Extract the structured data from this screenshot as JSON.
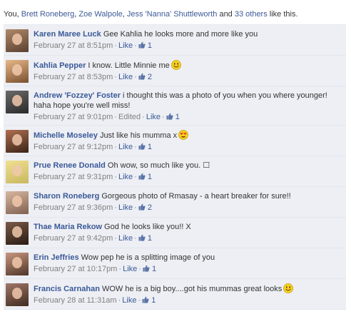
{
  "likes_summary": {
    "prefix": "You, ",
    "names": [
      "Brett Roneberg",
      "Zoe Walpole",
      "Jess 'Nanna' Shuttleworth"
    ],
    "joiner_comma": ", ",
    "joiner_and": " and ",
    "others": "33 others",
    "suffix": " like this."
  },
  "comments": [
    {
      "author": "Karen Maree Luck",
      "text": "Gee Kahlia he looks more and more like you",
      "timestamp": "February 27 at 8:51pm",
      "edited": "",
      "like_label": "Like",
      "like_count": "1",
      "emoji": "",
      "avatar_colors": [
        "#b08a6a",
        "#5a4030"
      ]
    },
    {
      "author": "Kahlia Pepper",
      "text": "I know. Little Minnie me",
      "timestamp": "February 27 at 8:53pm",
      "edited": "",
      "like_label": "Like",
      "like_count": "2",
      "emoji": "smile-emoji",
      "avatar_colors": [
        "#e8b888",
        "#7a5030"
      ]
    },
    {
      "author": "Andrew 'Fozzey' Foster",
      "text": "i thought this was a photo of you when you where younger! haha hope you're well miss!",
      "timestamp": "February 27 at 9:01pm",
      "edited": "Edited",
      "like_label": "Like",
      "like_count": "1",
      "emoji": "",
      "avatar_colors": [
        "#6a6a6a",
        "#2a2a2a"
      ]
    },
    {
      "author": "Michelle Moseley",
      "text": "Just like his mumma x",
      "timestamp": "February 27 at 9:12pm",
      "edited": "",
      "like_label": "Like",
      "like_count": "1",
      "emoji": "heart-eyes-emoji",
      "avatar_colors": [
        "#b07050",
        "#3a2418"
      ]
    },
    {
      "author": "Prue Renee Donald",
      "text": "Oh wow, so much like you. ☐",
      "timestamp": "February 27 at 9:31pm",
      "edited": "",
      "like_label": "Like",
      "like_count": "1",
      "emoji": "",
      "avatar_colors": [
        "#f0e090",
        "#c8b860"
      ]
    },
    {
      "author": "Sharon Roneberg",
      "text": "Gorgeous photo of Rmasay - a heart breaker for sure!!",
      "timestamp": "February 27 at 9:36pm",
      "edited": "",
      "like_label": "Like",
      "like_count": "2",
      "emoji": "",
      "avatar_colors": [
        "#d8b8a0",
        "#806050"
      ]
    },
    {
      "author": "Thae Maria Rekow",
      "text": "God he looks like you!! X",
      "timestamp": "February 27 at 9:42pm",
      "edited": "",
      "like_label": "Like",
      "like_count": "1",
      "emoji": "",
      "avatar_colors": [
        "#7a5a48",
        "#2a1a12"
      ]
    },
    {
      "author": "Erin Jeffries",
      "text": "Wow pep he is a splitting image of you",
      "timestamp": "February 27 at 10:17pm",
      "edited": "",
      "like_label": "Like",
      "like_count": "1",
      "emoji": "",
      "avatar_colors": [
        "#c89880",
        "#503428"
      ]
    },
    {
      "author": "Francis Carnahan",
      "text": "WOW he is a big boy....got his mummas great looks",
      "timestamp": "February 28 at 11:31am",
      "edited": "",
      "like_label": "Like",
      "like_count": "1",
      "emoji": "smile-emoji",
      "avatar_colors": [
        "#a07868",
        "#402a20"
      ]
    }
  ],
  "colors": {
    "link": "#3b5998",
    "meta": "#808080",
    "comment_bg": "#edeff4",
    "emoji_yellow": "#f5d020"
  },
  "icons": {
    "thumb": "thumbs-up-icon",
    "smile": "smile-emoji",
    "heart_eyes": "heart-eyes-emoji"
  }
}
